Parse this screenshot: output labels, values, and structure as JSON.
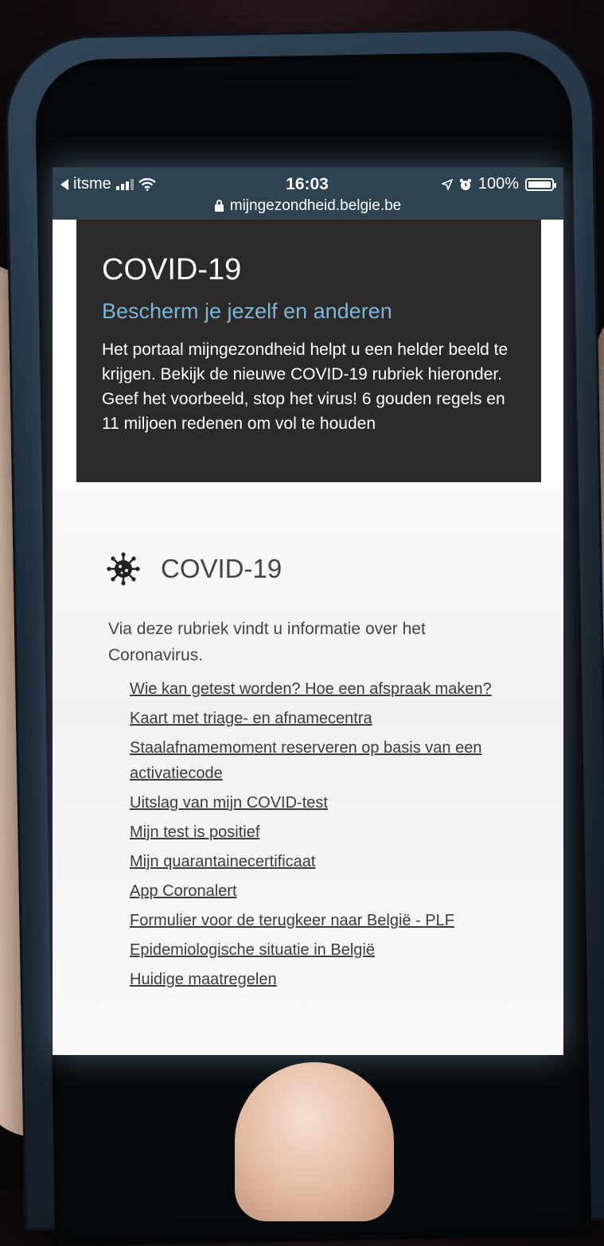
{
  "status_bar": {
    "carrier": "itsme",
    "time": "16:03",
    "battery": "100%",
    "battery_level": 1.0,
    "url": "mijngezondheid.belgie.be"
  },
  "hero": {
    "title": "COVID-19",
    "subtitle": "Bescherm je jezelf en anderen",
    "body": "Het portaal mijngezondheid helpt u een helder beeld te krijgen. Bekijk de nieuwe COVID-19 rubriek hieronder.  Geef het voorbeeld, stop het virus! 6 gouden regels en 11 miljoen redenen om vol te houden",
    "background": "#2b2a28",
    "subtitle_color": "#79b6da"
  },
  "section": {
    "icon": "virus-icon",
    "title": "COVID-19",
    "intro": "Via deze rubriek vindt u informatie over het Coronavirus.",
    "links": [
      "Wie kan getest worden? Hoe een afspraak maken?",
      "Kaart met triage- en afnamecentra",
      "Staalafnamemoment reserveren op basis van een activatiecode",
      "Uitslag van mijn COVID-test",
      "Mijn test is positief",
      "Mijn quarantainecertificaat",
      "App Coronalert",
      "Formulier voor de terugkeer naar België - PLF",
      "Epidemiologische situatie in België",
      "Huidige maatregelen"
    ]
  },
  "colors": {
    "status_bar": "#2f4250",
    "link": "#3c3c3c"
  }
}
